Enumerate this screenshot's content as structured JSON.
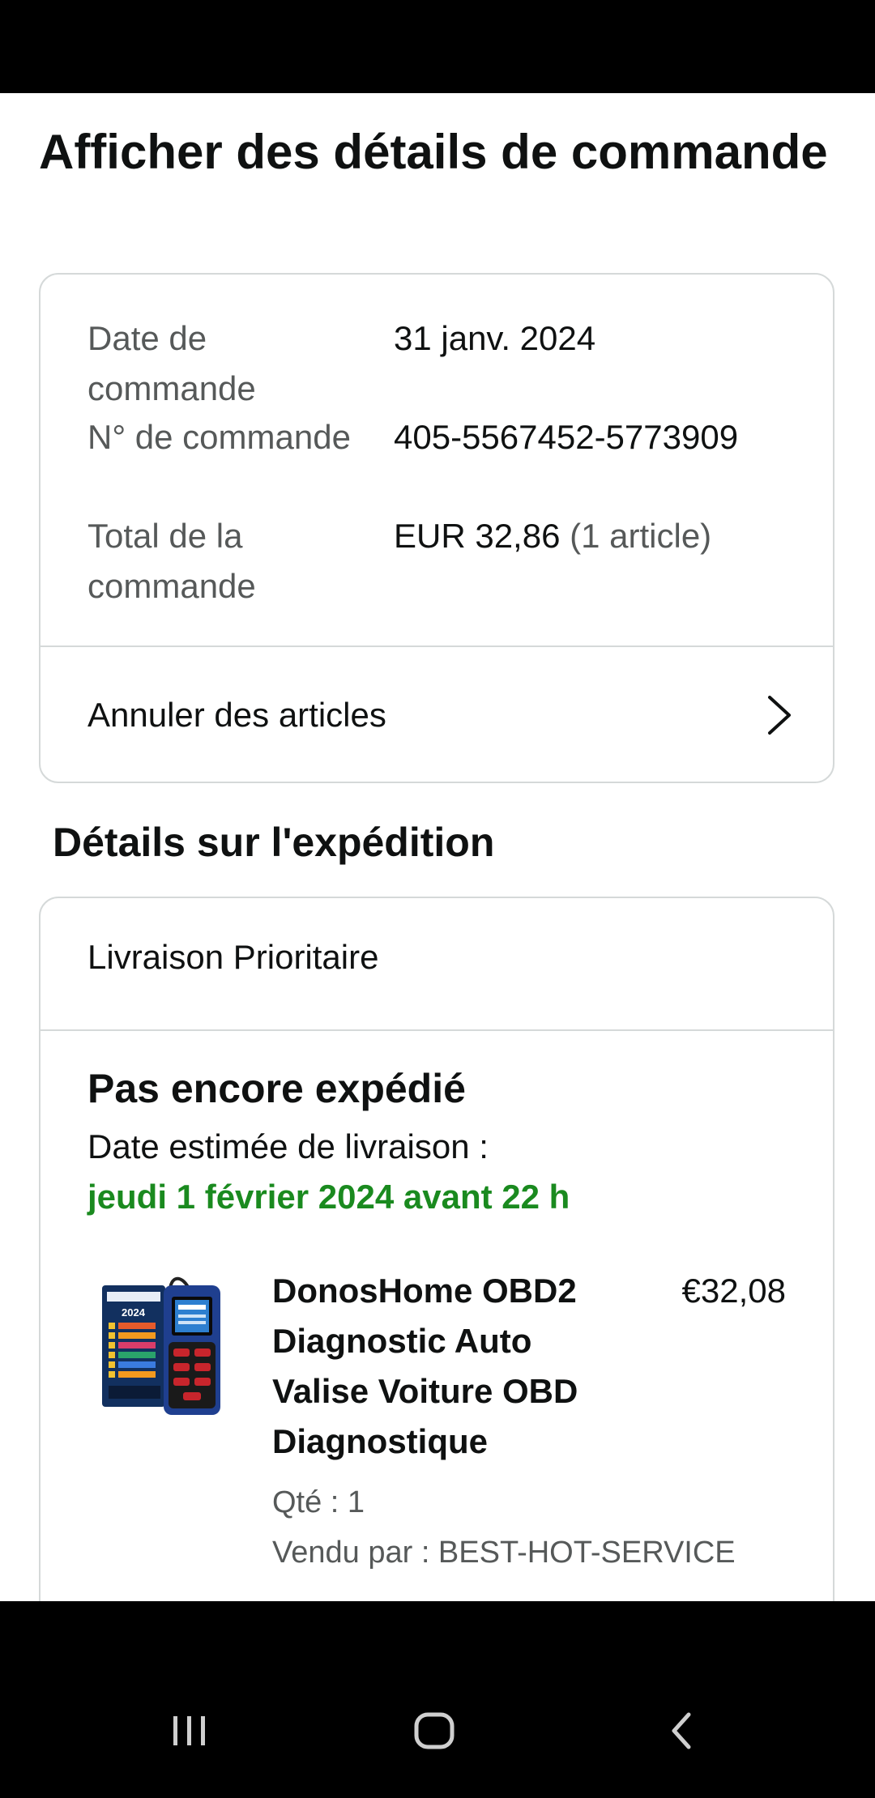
{
  "page": {
    "title": "Afficher des détails de commande"
  },
  "order": {
    "date_label": "Date de commande",
    "date_value": "31 janv. 2024",
    "number_label": "N° de commande",
    "number_value": "405-5567452-5773909",
    "total_label": "Total de la commande",
    "total_amount": "EUR 32,86",
    "total_count": "(1 article)",
    "cancel_label": "Annuler des articles"
  },
  "shipment": {
    "section_title": "Détails sur l'expédition",
    "method": "Livraison Prioritaire",
    "status": "Pas encore expédié",
    "delivery_label": "Date estimée de livraison :",
    "delivery_date": "jeudi 1 février 2024 avant 22 h"
  },
  "item": {
    "title": "DonosHome OBD2 Diagnostic Auto Valise Voiture OBD Diagnostique",
    "price": "€32,08",
    "quantity": "Qté : 1",
    "seller": "Vendu par : BEST-HOT-SERVICE",
    "image_icon": "obd2-scanner-product-image",
    "box_label": "2024"
  },
  "colors": {
    "delivery_green": "#1a8a1f",
    "card_border": "#d5d9d9",
    "text_primary": "#0f1111",
    "text_secondary": "#565959"
  },
  "nav": {
    "recents_icon": "recents-icon",
    "home_icon": "home-icon",
    "back_icon": "back-icon"
  }
}
